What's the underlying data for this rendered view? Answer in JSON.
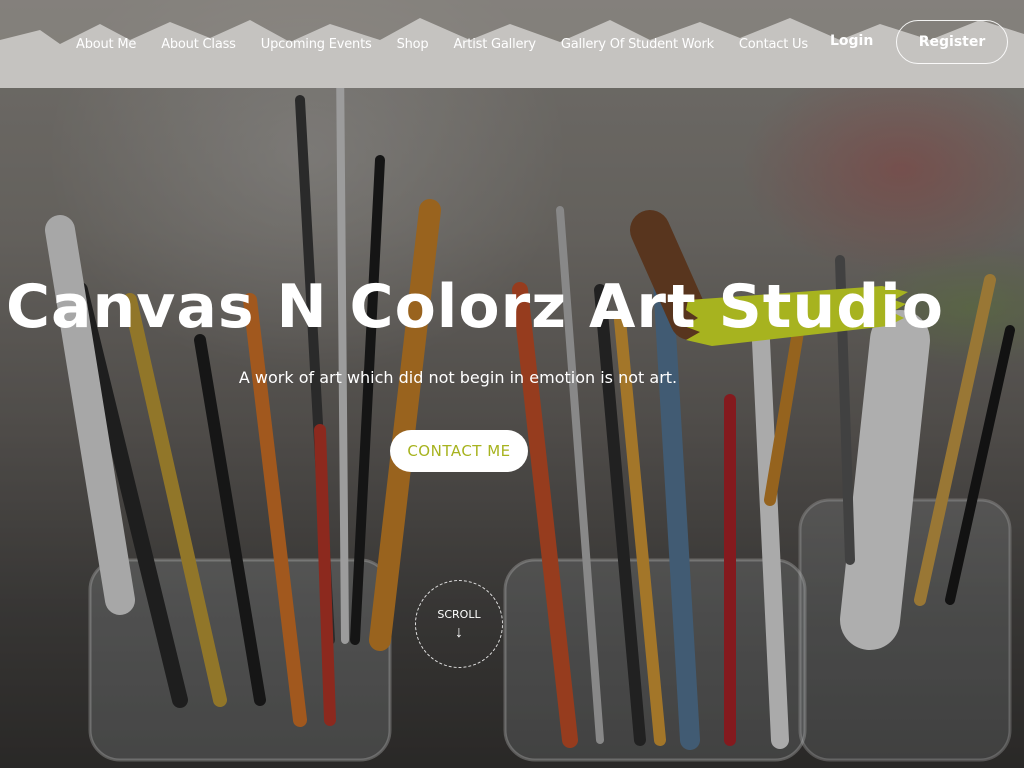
{
  "nav": {
    "items": [
      {
        "label": "About Me"
      },
      {
        "label": "About Class"
      },
      {
        "label": "Upcoming Events"
      },
      {
        "label": "Shop"
      },
      {
        "label": "Artist Gallery"
      },
      {
        "label": "Gallery Of Student Work"
      },
      {
        "label": "Contact Us"
      }
    ],
    "login_label": "Login",
    "register_label": "Register"
  },
  "hero": {
    "title_main": "Canvas N Colorz Art ",
    "title_accent": "Studio",
    "tagline": "A work of art which did not begin in emotion is not art.",
    "cta_label": "CONTACT ME",
    "scroll_label": "SCROLL"
  },
  "colors": {
    "accent": "#a7b31f",
    "text": "#ffffff"
  }
}
